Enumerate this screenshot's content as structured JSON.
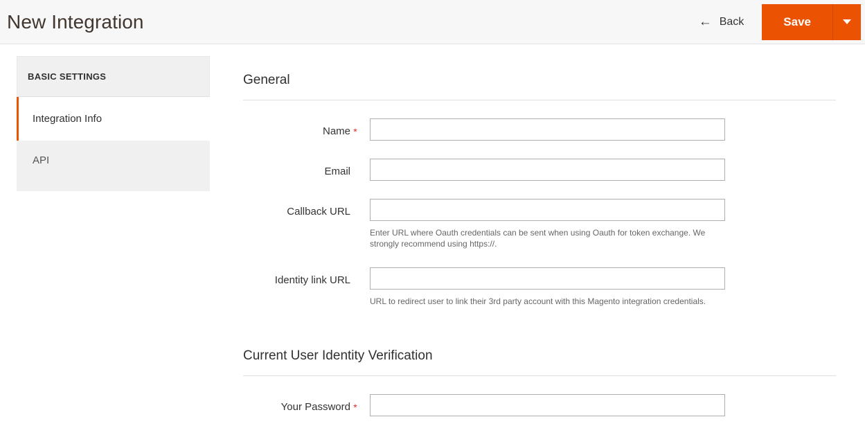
{
  "header": {
    "title": "New Integration",
    "back_label": "Back",
    "back_icon": "arrow-left-icon",
    "save_label": "Save",
    "save_toggle_icon": "chevron-down-icon",
    "accent_color": "#eb5202"
  },
  "sidebar": {
    "heading": "BASIC SETTINGS",
    "items": [
      {
        "label": "Integration Info",
        "active": true
      },
      {
        "label": "API",
        "active": false
      }
    ]
  },
  "main": {
    "sections": [
      {
        "title": "General",
        "fields": [
          {
            "label": "Name",
            "required": true,
            "value": "",
            "placeholder": "",
            "note": ""
          },
          {
            "label": "Email",
            "required": false,
            "value": "",
            "placeholder": "",
            "note": ""
          },
          {
            "label": "Callback URL",
            "required": false,
            "value": "",
            "placeholder": "",
            "note": "Enter URL where Oauth credentials can be sent when using Oauth for token exchange. We strongly recommend using https://."
          },
          {
            "label": "Identity link URL",
            "required": false,
            "value": "",
            "placeholder": "",
            "note": "URL to redirect user to link their 3rd party account with this Magento integration credentials."
          }
        ]
      },
      {
        "title": "Current User Identity Verification",
        "fields": [
          {
            "label": "Your Password",
            "required": true,
            "value": "",
            "placeholder": "",
            "note": ""
          }
        ]
      }
    ]
  },
  "symbols": {
    "arrow_left": "←",
    "asterisk": "*"
  }
}
